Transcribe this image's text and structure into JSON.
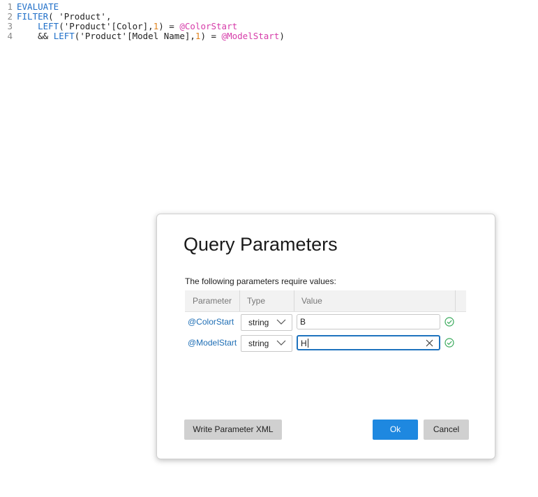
{
  "editor": {
    "lines": [
      {
        "num": "1",
        "parts": [
          {
            "t": "EVALUATE",
            "c": "kw"
          }
        ]
      },
      {
        "num": "2",
        "parts": [
          {
            "t": "FILTER",
            "c": "kw"
          },
          {
            "t": "( ",
            "c": "txt"
          },
          {
            "t": "'Product'",
            "c": "str"
          },
          {
            "t": ",",
            "c": "txt"
          }
        ]
      },
      {
        "num": "3",
        "parts": [
          {
            "t": "    ",
            "c": "txt"
          },
          {
            "t": "LEFT",
            "c": "kw"
          },
          {
            "t": "(",
            "c": "txt"
          },
          {
            "t": "'Product'",
            "c": "str"
          },
          {
            "t": "[Color],",
            "c": "txt"
          },
          {
            "t": "1",
            "c": "num"
          },
          {
            "t": ") = ",
            "c": "txt"
          },
          {
            "t": "@ColorStart",
            "c": "param"
          }
        ]
      },
      {
        "num": "4",
        "parts": [
          {
            "t": "    && ",
            "c": "txt"
          },
          {
            "t": "LEFT",
            "c": "kw"
          },
          {
            "t": "(",
            "c": "txt"
          },
          {
            "t": "'Product'",
            "c": "str"
          },
          {
            "t": "[Model Name],",
            "c": "txt"
          },
          {
            "t": "1",
            "c": "num"
          },
          {
            "t": ") = ",
            "c": "txt"
          },
          {
            "t": "@ModelStart",
            "c": "param"
          },
          {
            "t": ")",
            "c": "txt"
          }
        ]
      }
    ]
  },
  "dialog": {
    "title": "Query Parameters",
    "subtitle": "The following parameters require values:",
    "columns": {
      "parameter": "Parameter",
      "type": "Type",
      "value": "Value"
    },
    "rows": [
      {
        "name": "@ColorStart",
        "type": "string",
        "value": "B",
        "valid_icon": "check-circle-icon"
      },
      {
        "name": "@ModelStart",
        "type": "string",
        "value": "H",
        "valid_icon": "check-circle-icon"
      }
    ],
    "buttons": {
      "write_xml": "Write Parameter XML",
      "ok": "Ok",
      "cancel": "Cancel"
    }
  },
  "colors": {
    "accent": "#1e88e0",
    "keyword": "#1e6ec8",
    "parameter": "#d63ca9",
    "number": "#e0821c",
    "valid": "#3aaa5c"
  }
}
